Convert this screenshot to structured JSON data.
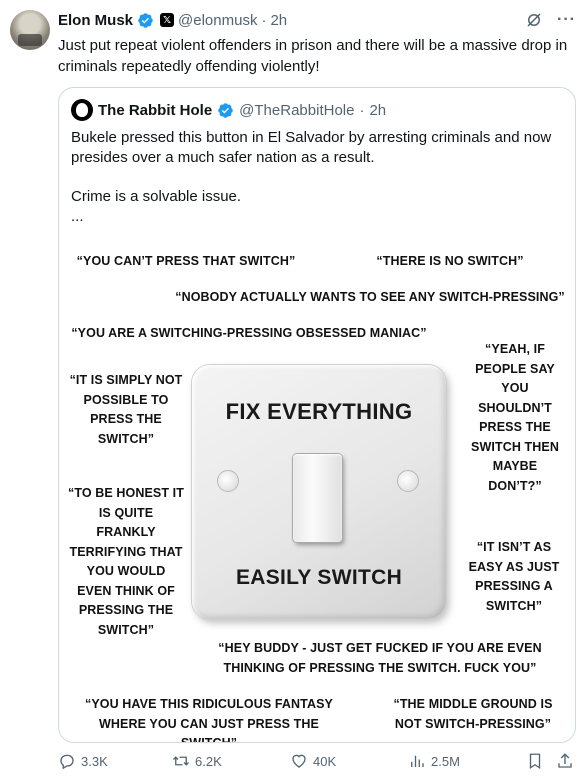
{
  "tweet": {
    "author_name": "Elon Musk",
    "handle": "@elonmusk",
    "separator": "·",
    "time": "2h",
    "text": "Just put repeat violent offenders in prison and there will be a massive drop in criminals repeatedly offending violently!",
    "more_label": "···"
  },
  "quote": {
    "author_name": "The Rabbit Hole",
    "handle": "@TheRabbitHole",
    "separator": "·",
    "time": "2h",
    "paragraph1": "Bukele pressed this button in El Salvador by arresting criminals and now presides over a much safer nation as a result.",
    "paragraph2": "Crime is a solvable issue.",
    "ellipsis": "..."
  },
  "meme": {
    "switch_top": "FIX EVERYTHING",
    "switch_bottom": "EASILY SWITCH",
    "captions": {
      "c1": "“YOU CAN’T PRESS THAT SWITCH”",
      "c2": "“THERE IS NO SWITCH”",
      "c3": "“NOBODY ACTUALLY WANTS TO SEE ANY SWITCH-PRESSING”",
      "c4": "“YOU ARE A SWITCHING-PRESSING OBSESSED MANIAC”",
      "c5": "“YEAH, IF PEOPLE SAY YOU SHOULDN’T PRESS THE SWITCH THEN MAYBE DON’T?”",
      "c6": "“IT IS SIMPLY NOT POSSIBLE TO PRESS THE SWITCH”",
      "c7": "“TO BE HONEST IT IS QUITE FRANKLY TERRIFYING THAT YOU WOULD EVEN THINK OF PRESSING THE SWITCH”",
      "c8": "“IT ISN’T AS EASY AS JUST PRESSING A SWITCH”",
      "c9": "“HEY BUDDY - JUST GET FUCKED IF YOU ARE EVEN THINKING OF PRESSING THE SWITCH. FUCK YOU”",
      "c10": "“YOU HAVE THIS RIDICULOUS FANTASY WHERE YOU CAN JUST PRESS THE SWITCH”",
      "c11": "“THE MIDDLE GROUND IS NOT SWITCH-PRESSING”"
    }
  },
  "actions": {
    "replies": "3.3K",
    "reposts": "6.2K",
    "likes": "40K",
    "views": "2.5M"
  },
  "colors": {
    "verified_blue": "#1d9bf0",
    "muted_text": "#536471",
    "border": "#cfd9de"
  }
}
